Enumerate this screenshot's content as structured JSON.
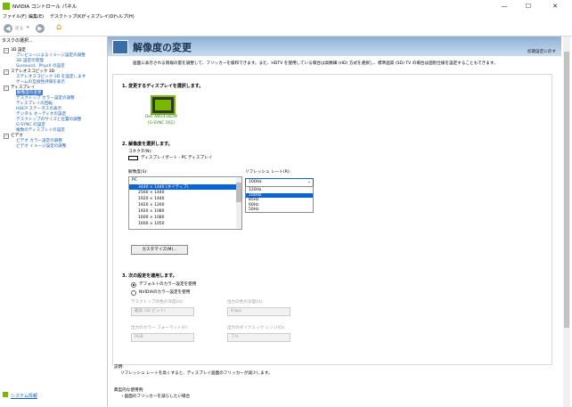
{
  "window": {
    "title": "NVIDIA コントロール パネル",
    "minimize": "—",
    "maximize": "☐",
    "close": "✕"
  },
  "menu": [
    "ファイル(F)",
    "編集(E)",
    "デスクトップ(K)",
    "ディスプレイ(D)",
    "ヘルプ(H)"
  ],
  "toolbar": {
    "back_label": "戻る",
    "back_icon": "◀",
    "forward_icon": "▶",
    "dropdown_icon": "▾",
    "home_icon": "⌂"
  },
  "sidebar": {
    "heading": "タスクの選択...",
    "sections": [
      {
        "label": "3D 設定",
        "items": [
          "プレビューによるイメージ設定の調整",
          "3D 設定の管理",
          "Surround、PhysX の設定"
        ]
      },
      {
        "label": "ステレオスコピック 3D",
        "items": [
          "ステレオスコピック 3D を設定します",
          "ゲームの互換性評価を表示"
        ]
      },
      {
        "label": "ディスプレイ",
        "items": [
          "解像度の変更",
          "デスクトップ カラー設定の調整",
          "ディスプレイの回転",
          "HDCP ステータスの表示",
          "デジタル オーディオの設定",
          "デスクトップのサイズと位置の調整",
          "G-SYNC の設定",
          "複数のディスプレイの設定"
        ]
      },
      {
        "label": "ビデオ",
        "items": [
          "ビデオ カラー設定の調整",
          "ビデオ イメージ設定の調整"
        ]
      }
    ],
    "selected": "解像度の変更",
    "system_info": "システム情報"
  },
  "page": {
    "title": "解像度の変更",
    "restore": "初期設定に戻す",
    "description": "画面に表示される情報の量を調整して、フリッカーを緩和できます。また、HDTV を使用している場合は高精細 (HD) 方式を選択し、標準画質 (SD) TV の場合は国別仕様を設定することもできます。",
    "step1": "1. 変更するディスプレイを選択します。",
    "monitor_name": "Dell AW2418DW",
    "monitor_sub": "(G-SYNC 対応)",
    "step2": "2. 解像度を選択します。",
    "connector_label": "コネクタ(N):",
    "connector_value": "ディスプレイポート - PC ディスプレイ",
    "resolution_label": "解像度(S):",
    "refresh_label": "リフレッシュ レート(R):",
    "resolutions": [
      "PC",
      "3440 × 1440 (ネイティブ)",
      "2560 × 1440",
      "1920 × 1440",
      "1920 × 1200",
      "1920 × 1080",
      "1600 × 1080",
      "1600 × 1050"
    ],
    "selected_resolution": "3440 × 1440 (ネイティブ)",
    "refresh_value": "100Hz",
    "refresh_options": [
      "120Hz",
      "100Hz",
      "85Hz",
      "60Hz",
      "50Hz"
    ],
    "selected_refresh": "100Hz",
    "customize": "カスタマイズ(M)...",
    "step3": "3. 次の設定を適用します。",
    "radio_default": "デフォルトのカラー設定を使用",
    "radio_nvidia": "NVIDIAのカラー設定を使用",
    "desktop_color_depth_label": "デスクトップの色の深度(U):",
    "desktop_color_depth_value": "最高 (32 ビット)",
    "output_color_depth_label": "出力の色の深度(U):",
    "output_color_depth_value": "8 bpc",
    "output_color_format_label": "出力のカラー フォーマット(F):",
    "output_color_format_value": "RGB",
    "output_dynamic_range_label": "出力のダイナミック レンジ(O):",
    "output_dynamic_range_value": "フル",
    "explanation_label": "説明:",
    "explanation_text": "リフレッシュ レートを高くすると、ディスプレイ画面のフリッカーが減少します。",
    "typical_label": "典型的な使用例:",
    "typical_text": "・画面のフリッカーを減らしたい場合"
  }
}
